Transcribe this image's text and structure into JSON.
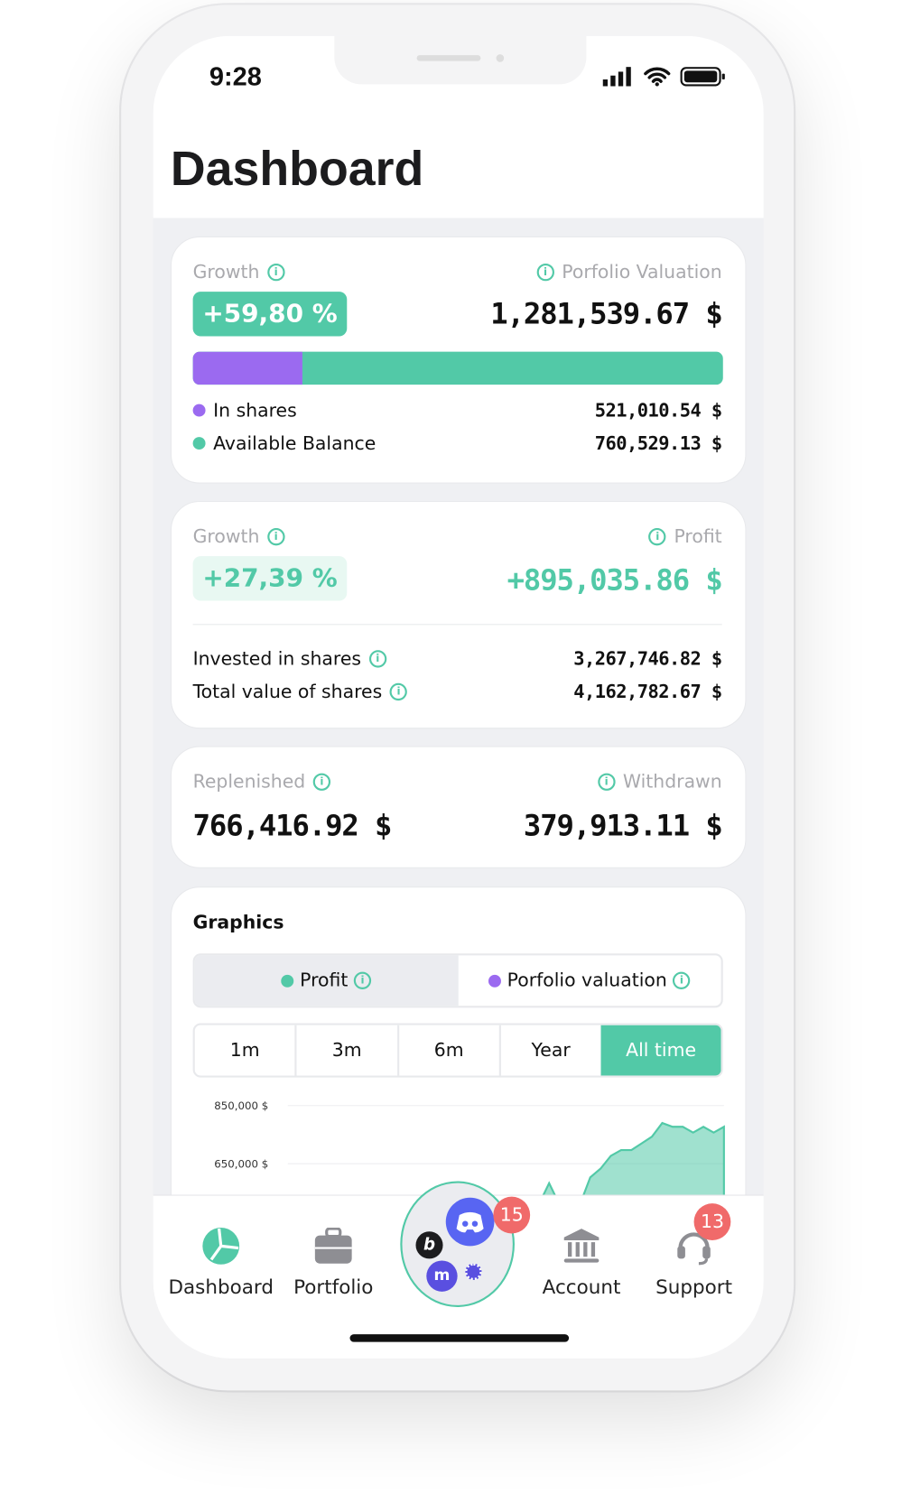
{
  "status_bar": {
    "time": "9:28"
  },
  "header": {
    "title": "Dashboard"
  },
  "colors": {
    "accent": "#52c9a7",
    "purple": "#9b6af0",
    "badge": "#f06a6a"
  },
  "valuation_card": {
    "growth_label": "Growth",
    "growth_value": "+59,80 %",
    "valuation_label": "Porfolio Valuation",
    "valuation_value": "1,281,539.67 $",
    "shares_fraction": 0.2066,
    "rows": [
      {
        "label": "In shares",
        "value": "521,010.54 $"
      },
      {
        "label": "Available Balance",
        "value": "760,529.13 $"
      }
    ]
  },
  "profit_card": {
    "growth_label": "Growth",
    "growth_value": "+27,39 %",
    "profit_label": "Profit",
    "profit_value": "+895,035.86 $",
    "rows": [
      {
        "label": "Invested in shares",
        "value": "3,267,746.82 $"
      },
      {
        "label": "Total value of shares",
        "value": "4,162,782.67 $"
      }
    ]
  },
  "flow_card": {
    "replenished_label": "Replenished",
    "replenished_value": "766,416.92 $",
    "withdrawn_label": "Withdrawn",
    "withdrawn_value": "379,913.11 $"
  },
  "graphics": {
    "title": "Graphics",
    "toggle": [
      {
        "label": "Profit",
        "active": true
      },
      {
        "label": "Porfolio valuation",
        "active": false
      }
    ],
    "periods": [
      "1m",
      "3m",
      "6m",
      "Year",
      "All time"
    ],
    "active_period": "All time"
  },
  "chart_data": {
    "type": "area",
    "y_ticks": [
      "850,000 $",
      "650,000 $"
    ],
    "y_tick_values": [
      850000,
      650000
    ],
    "grid": true,
    "color": "#52c9a7",
    "values": [
      510000,
      583000,
      510000,
      480000,
      510000,
      603000,
      633000,
      677000,
      697000,
      697000,
      720000,
      743000,
      790000,
      777000,
      777000,
      757000,
      777000,
      757000,
      777000
    ]
  },
  "tabbar": {
    "items": [
      {
        "label": "Dashboard",
        "icon": "pie-chart-icon",
        "active": true
      },
      {
        "label": "Portfolio",
        "icon": "briefcase-icon"
      },
      {
        "label": "Account",
        "icon": "bank-icon"
      },
      {
        "label": "Support",
        "icon": "headset-icon",
        "badge": "13"
      }
    ],
    "center_badge": "15"
  }
}
